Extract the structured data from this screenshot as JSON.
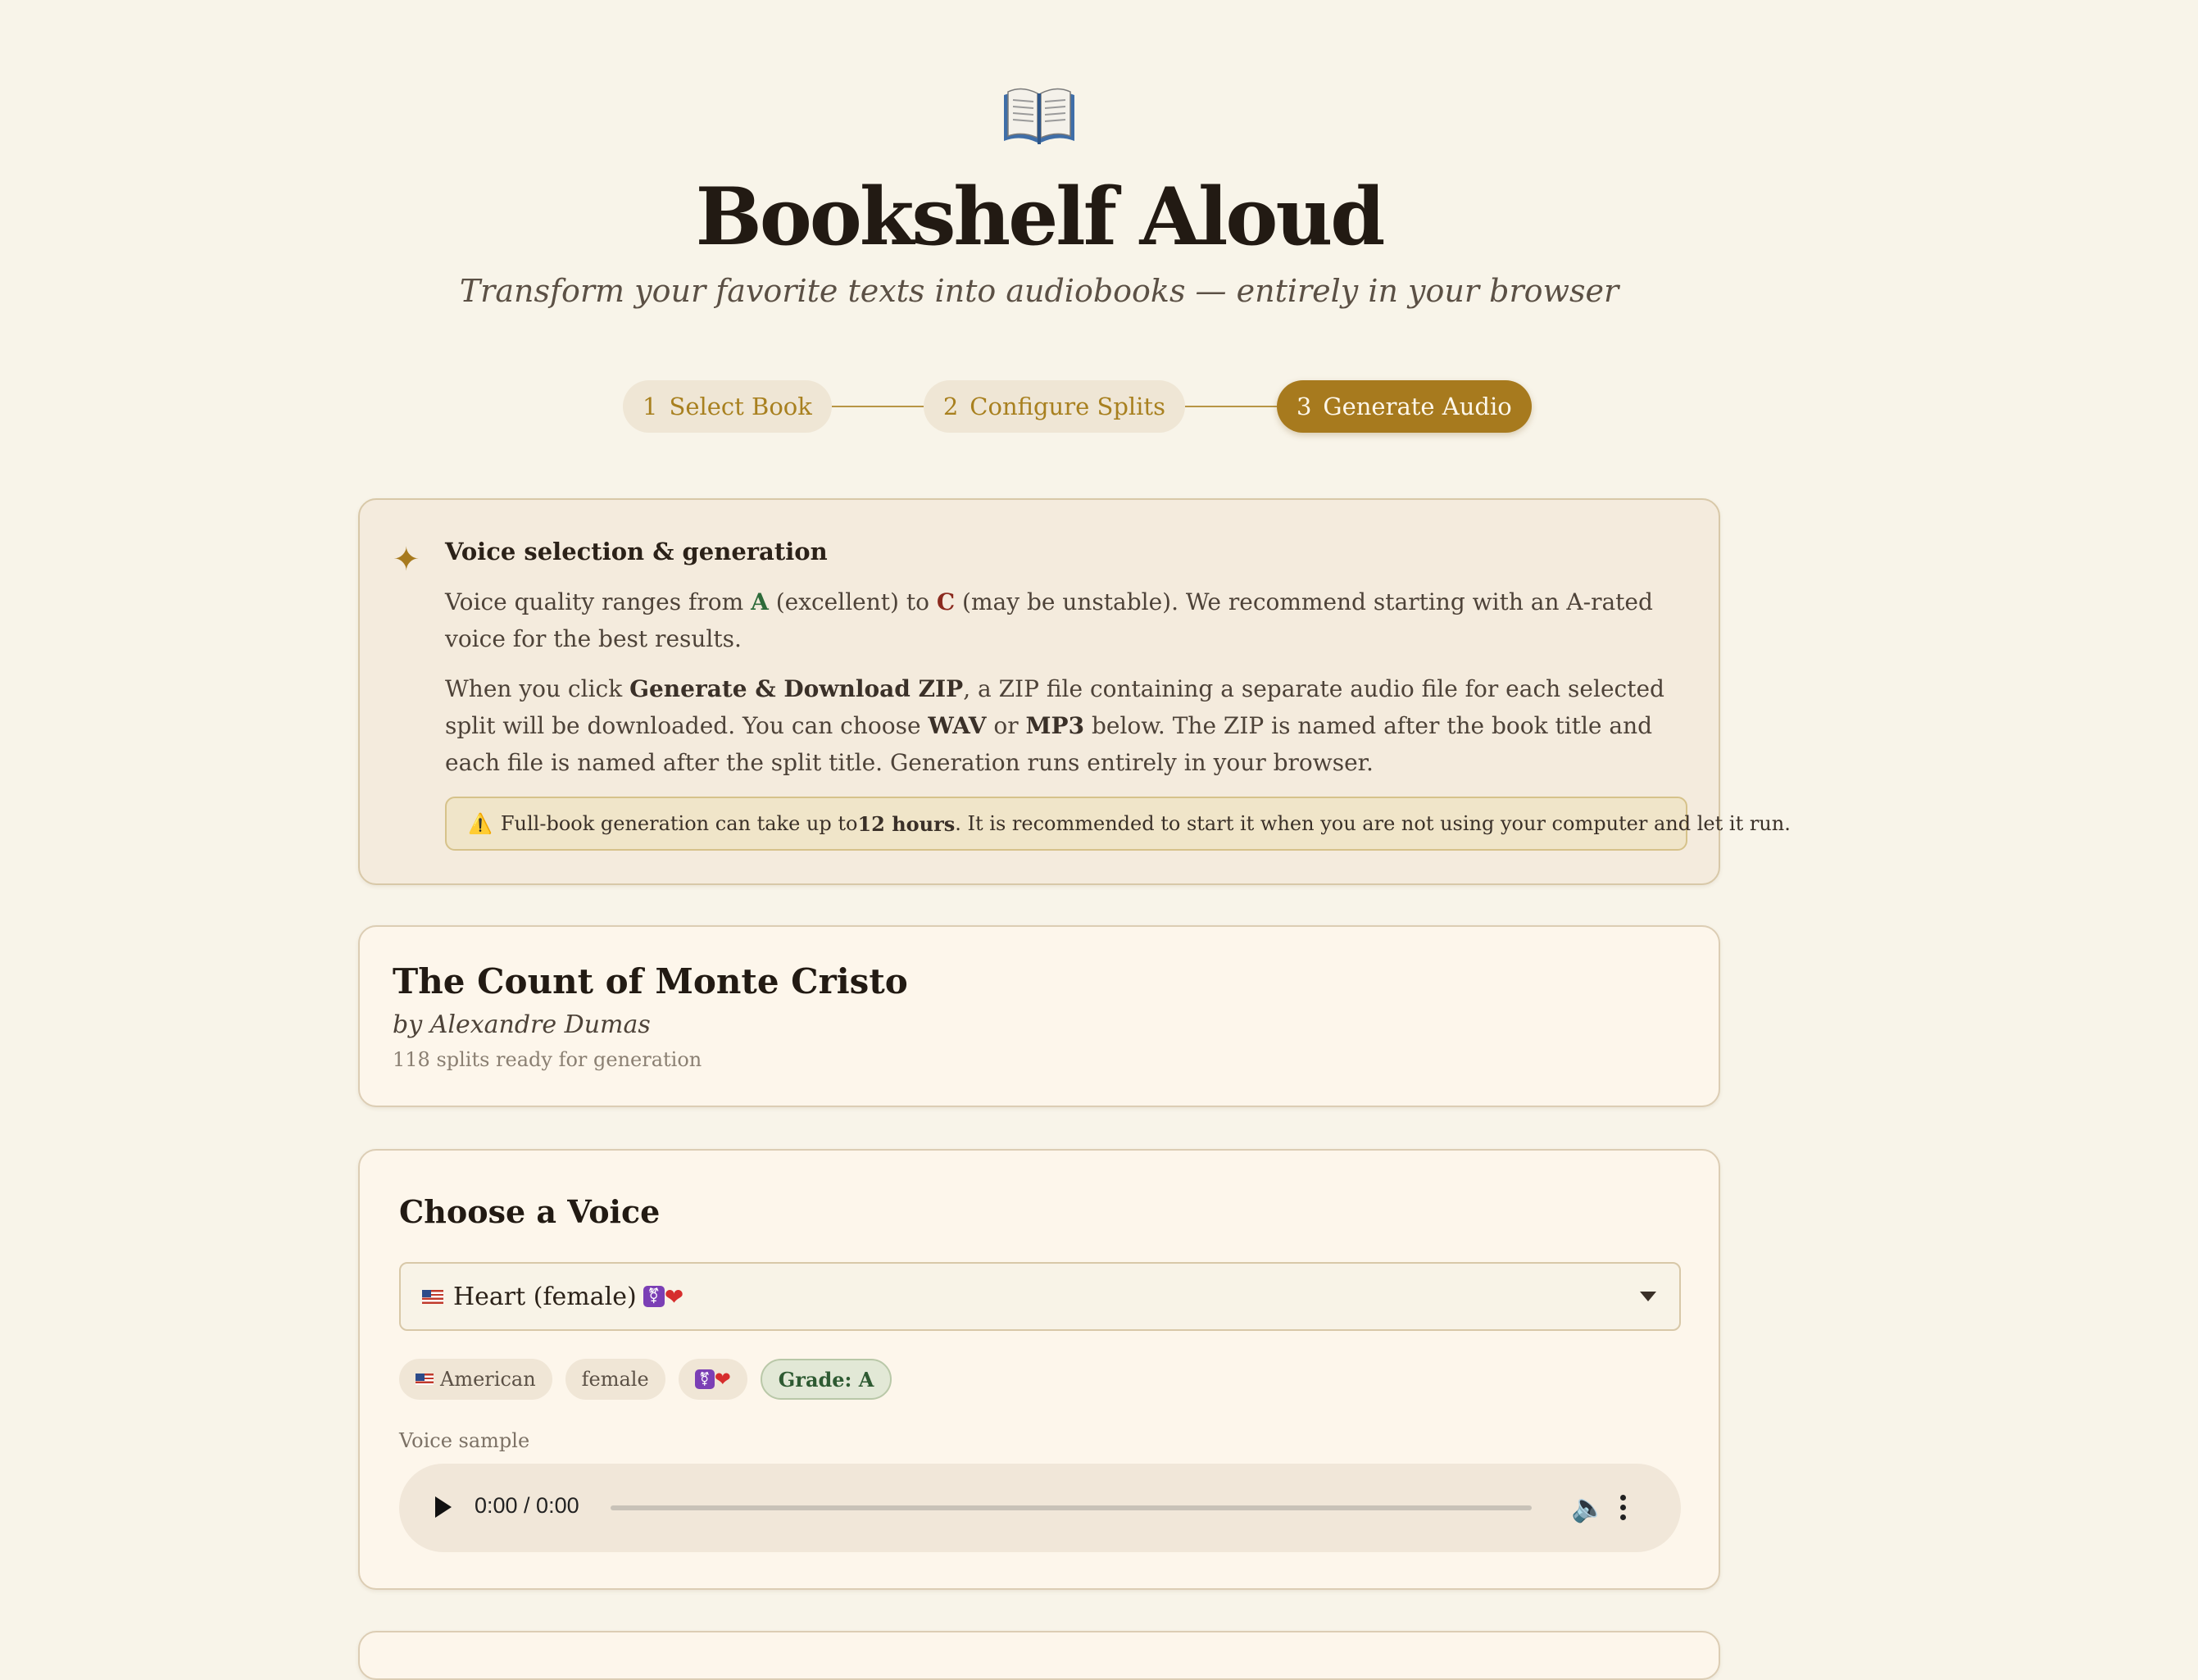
{
  "app": {
    "title": "Bookshelf Aloud",
    "subtitle": "Transform your favorite texts into audiobooks — entirely in your browser",
    "logo_icon": "open-book-icon"
  },
  "stepper": {
    "steps": [
      {
        "num": "1",
        "label": "Select Book",
        "active": false
      },
      {
        "num": "2",
        "label": "Configure Splits",
        "active": false
      },
      {
        "num": "3",
        "label": "Generate Audio",
        "active": true
      }
    ]
  },
  "info": {
    "heading": "Voice selection & generation",
    "p1_a": "Voice quality ranges from ",
    "p1_grade_a": "A",
    "p1_b": " (excellent) to ",
    "p1_grade_c": "C",
    "p1_c": " (may be unstable). We recommend starting with an A-rated voice for the best results.",
    "p2_a": "When you click ",
    "p2_btn": "Generate & Download ZIP",
    "p2_b": ", a ZIP file containing a separate audio file for each selected split will be downloaded. You can choose ",
    "p2_wav": "WAV",
    "p2_or": " or ",
    "p2_mp3": "MP3",
    "p2_c": " below. The ZIP is named after the book title and each file is named after the split title. Generation runs entirely in your browser.",
    "warning_icon": "⚠️",
    "warning_a": "Full-book generation can take up to ",
    "warning_bold": "12 hours",
    "warning_b": ". It is recommended to start it when you are not using your computer and let it run."
  },
  "book": {
    "title": "The Count of Monte Cristo",
    "author": "by Alexandre Dumas",
    "meta": "118 splits ready for generation"
  },
  "voice": {
    "heading": "Choose a Voice",
    "selected": "Heart (female)",
    "tags": {
      "accent": "American",
      "gender": "female",
      "grade": "Grade: A"
    },
    "sample_label": "Voice sample",
    "player_time": "0:00 / 0:00"
  },
  "colors": {
    "accent": "#a77a1e",
    "background": "#f8f4e9",
    "grade_a": "#2e6b3a",
    "grade_c": "#8b2a1e"
  }
}
